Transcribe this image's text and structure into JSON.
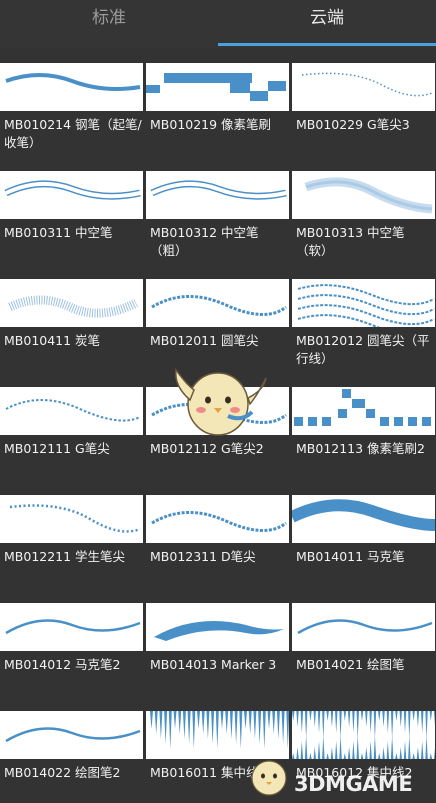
{
  "tabs": {
    "standard": "标准",
    "cloud": "云端"
  },
  "brushes": [
    {
      "label": "MB010214 钢笔（起笔/收笔）",
      "style": "wave-thick"
    },
    {
      "label": "MB010219 像素笔刷",
      "style": "pixel"
    },
    {
      "label": "MB010229 G笔尖3",
      "style": "dotted"
    },
    {
      "label": "MB010311 中空笔",
      "style": "hollow"
    },
    {
      "label": "MB010312 中空笔（粗）",
      "style": "hollow"
    },
    {
      "label": "MB010313 中空笔（软）",
      "style": "soft"
    },
    {
      "label": "MB010411 炭笔",
      "style": "charcoal"
    },
    {
      "label": "MB012011 圆笔尖",
      "style": "rough"
    },
    {
      "label": "MB012012 圆笔尖（平行线）",
      "style": "parallel"
    },
    {
      "label": "MB012111 G笔尖",
      "style": "rough-dotted"
    },
    {
      "label": "MB012112 G笔尖2",
      "style": "rough"
    },
    {
      "label": "MB012113 像素笔刷2",
      "style": "pixel-blocks"
    },
    {
      "label": "MB012211 学生笔尖",
      "style": "dotted-bold"
    },
    {
      "label": "MB012311 D笔尖",
      "style": "rough"
    },
    {
      "label": "MB014011 马克笔",
      "style": "marker"
    },
    {
      "label": "MB014012 马克笔2",
      "style": "wave-thin"
    },
    {
      "label": "MB014013 Marker 3",
      "style": "marker-tapered"
    },
    {
      "label": "MB014021 绘图笔",
      "style": "wave-thin"
    },
    {
      "label": "MB014022 绘图笔2",
      "style": "wave-thin"
    },
    {
      "label": "MB016011 集中线",
      "style": "spikes"
    },
    {
      "label": "MB016012 集中线2",
      "style": "spikes2"
    }
  ],
  "colors": {
    "accent": "#4aa3df",
    "stroke": "#4a90c8"
  },
  "watermark": "3DMGAME"
}
